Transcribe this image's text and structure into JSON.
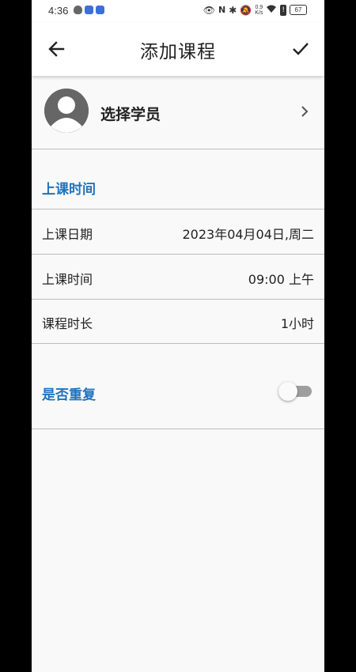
{
  "status_bar": {
    "time": "4:36",
    "net_speed_value": "0.9",
    "net_speed_unit": "K/s",
    "battery": "67"
  },
  "app_bar": {
    "title": "添加课程",
    "back_icon": "arrow-left-icon",
    "confirm_icon": "check-icon"
  },
  "student": {
    "label": "选择学员",
    "avatar_icon": "person-avatar-icon"
  },
  "schedule": {
    "section_title": "上课时间",
    "rows": [
      {
        "label": "上课日期",
        "value": "2023年04月04日,周二"
      },
      {
        "label": "上课时间",
        "value": "09:00 上午"
      },
      {
        "label": "课程时长",
        "value": "1小时"
      }
    ]
  },
  "repeat": {
    "label": "是否重复",
    "enabled": false
  },
  "colors": {
    "accent": "#1e73be",
    "background": "#f9f9f9",
    "divider": "#bdbdbd"
  }
}
